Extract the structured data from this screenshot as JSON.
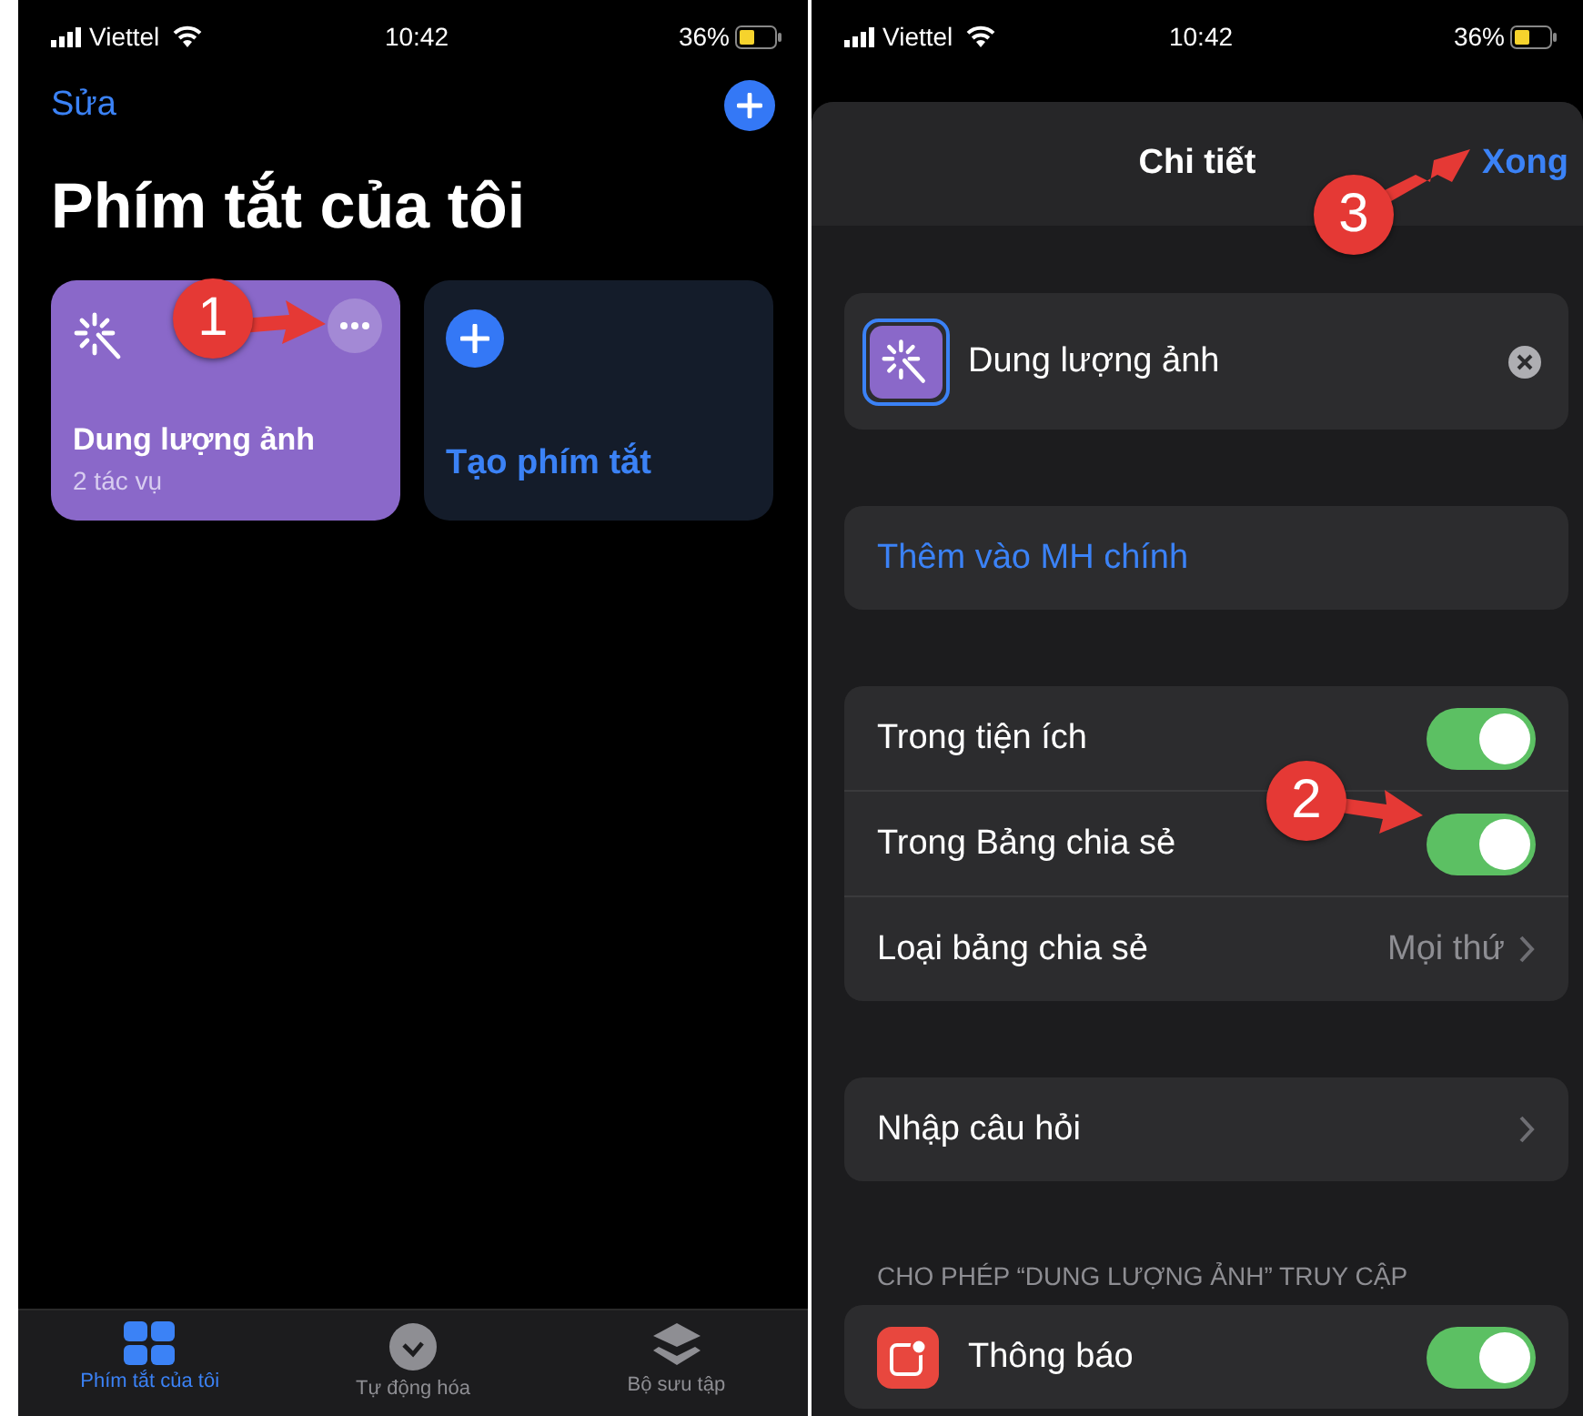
{
  "left_screen": {
    "status_bar": {
      "carrier": "Viettel",
      "time": "10:42",
      "battery": "36%"
    },
    "nav": {
      "edit": "Sửa"
    },
    "title": "Phím tắt của tôi",
    "cards": [
      {
        "kind": "shortcut",
        "name": "Dung lượng ảnh",
        "subtitle": "2 tác vụ",
        "color": "#8a68c9"
      },
      {
        "kind": "create",
        "name": "Tạo phím tắt"
      }
    ],
    "tab_bar": [
      {
        "label": "Phím tắt của tôi",
        "selected": true,
        "kind": "grid"
      },
      {
        "label": "Tự động hóa",
        "selected": false,
        "kind": "clock"
      },
      {
        "label": "Bộ sưu tập",
        "selected": false,
        "kind": "layers"
      }
    ]
  },
  "right_screen": {
    "status_bar": {
      "carrier": "Viettel",
      "time": "10:42",
      "battery": "36%"
    },
    "sheet": {
      "title": "Chi tiết",
      "done": "Xong",
      "name_field": {
        "value": "Dung lượng ảnh"
      },
      "add_home": "Thêm vào MH chính",
      "settings": [
        {
          "kind": "toggle",
          "label": "Trong tiện ích",
          "on": true
        },
        {
          "kind": "toggle",
          "label": "Trong Bảng chia sẻ",
          "on": true
        },
        {
          "kind": "link",
          "label": "Loại bảng chia sẻ",
          "value": "Mọi thứ"
        }
      ],
      "question": {
        "label": "Nhập câu hỏi"
      },
      "section_header": "CHO PHÉP “DUNG LƯỢNG ẢNH” TRUY CẬP",
      "permissions": [
        {
          "label": "Thông báo",
          "on": true
        }
      ]
    }
  },
  "annotations": [
    {
      "label": "1"
    },
    {
      "label": "2"
    },
    {
      "label": "3"
    }
  ]
}
